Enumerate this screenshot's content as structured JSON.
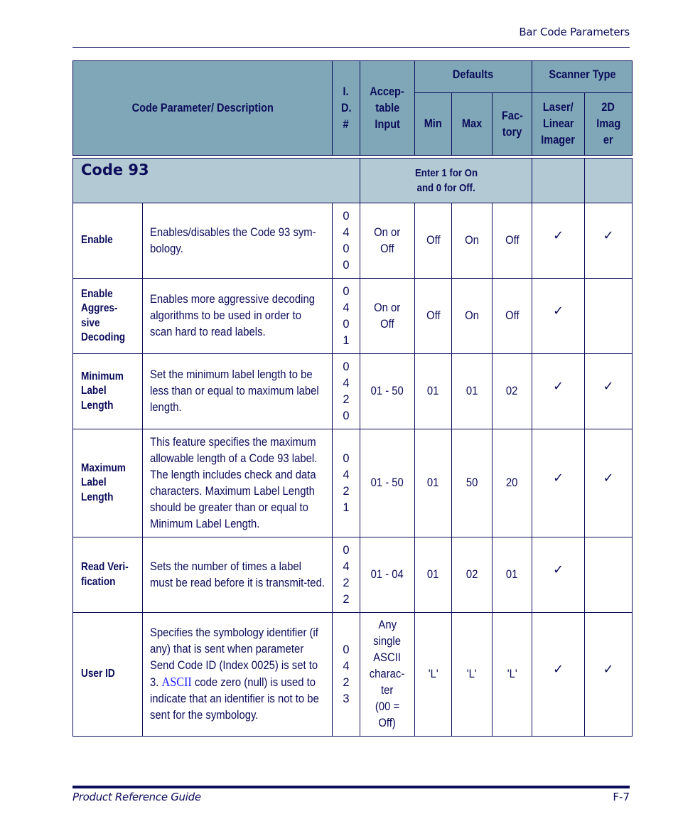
{
  "header": {
    "running_title": "Bar Code Parameters"
  },
  "table": {
    "headers": {
      "code_param": "Code Parameter/ Description",
      "id": [
        "I.",
        "D.",
        "#"
      ],
      "acceptable_input": [
        "Accep-",
        "table",
        "Input"
      ],
      "defaults": "Defaults",
      "scanner_type": "Scanner Type",
      "min": "Min",
      "max": "Max",
      "factory": [
        "Fac-",
        "tory"
      ],
      "laser": [
        "Laser/",
        "Linear",
        "Imager"
      ],
      "imager2d": [
        "2D",
        "Imag",
        "er"
      ]
    },
    "section": {
      "title": "Code 93",
      "note": [
        "Enter 1 for On",
        "and 0 for Off."
      ]
    },
    "check_icon": "✓",
    "rows": [
      {
        "name": [
          "Enable"
        ],
        "description": "Enables/disables the Code 93 sym-bology.",
        "id": [
          "0",
          "4",
          "0",
          "0"
        ],
        "input": [
          "On or",
          "Off"
        ],
        "min": "Off",
        "max": "On",
        "factory": "Off",
        "laser": true,
        "imager2d": true
      },
      {
        "name": [
          "Enable",
          "Aggres-",
          "sive",
          "Decoding"
        ],
        "description": "Enables more aggressive decoding algorithms to be used in order to scan hard to read labels.",
        "id": [
          "0",
          "4",
          "0",
          "1"
        ],
        "input": [
          "On or",
          "Off"
        ],
        "min": "Off",
        "max": "On",
        "factory": "Off",
        "laser": true,
        "imager2d": false
      },
      {
        "name": [
          "Minimum",
          "Label",
          "Length"
        ],
        "description": "Set the minimum label length to be less than or equal to maximum label length.",
        "id": [
          "0",
          "4",
          "2",
          "0"
        ],
        "input": [
          "01 - 50"
        ],
        "min": "01",
        "max": "01",
        "factory": "02",
        "laser": true,
        "imager2d": true
      },
      {
        "name": [
          "Maximum",
          "Label",
          "Length"
        ],
        "description": "This feature specifies the maximum allowable length of a Code 93 label. The length includes check and data characters. Maximum Label Length should be greater than or equal to Minimum Label Length.",
        "id": [
          "0",
          "4",
          "2",
          "1"
        ],
        "input": [
          "01 - 50"
        ],
        "min": "01",
        "max": "50",
        "factory": "20",
        "laser": true,
        "imager2d": true
      },
      {
        "name": [
          "Read Veri-",
          "fication"
        ],
        "description": "Sets the number of times a label must be read before it is transmit-ted.",
        "id": [
          "0",
          "4",
          "2",
          "2"
        ],
        "input": [
          "01 - 04"
        ],
        "min": "01",
        "max": "02",
        "factory": "01",
        "laser": true,
        "imager2d": false
      },
      {
        "name": [
          "User ID"
        ],
        "description_pre": "Specifies the symbology identifier (if any) that is sent when parameter Send Code ID (Index 0025) is set to 3. ",
        "description_link": "ASCII",
        "description_post": " code zero (null) is used to indicate that an identifier is not to be sent for the symbology.",
        "id": [
          "0",
          "4",
          "2",
          "3"
        ],
        "input": [
          "Any",
          "single",
          "ASCII",
          "charac-",
          "ter",
          "(00 =",
          "Off)"
        ],
        "min": "'L'",
        "max": "'L'",
        "factory": "'L'",
        "laser": true,
        "imager2d": true
      }
    ]
  },
  "footer": {
    "guide_title": "Product Reference Guide",
    "page_number": "F-7"
  }
}
